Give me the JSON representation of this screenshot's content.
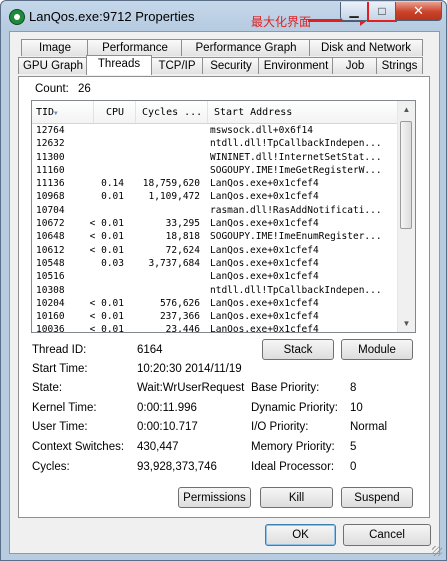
{
  "window": {
    "title": "LanQos.exe:9712 Properties",
    "annotation": "最大化界面",
    "controls": {
      "minimize": "▁",
      "maximize": "□",
      "close": "✕"
    }
  },
  "tabs_row1": [
    "Image",
    "Performance",
    "Performance Graph",
    "Disk and Network"
  ],
  "tabs_row2": [
    "GPU Graph",
    "Threads",
    "TCP/IP",
    "Security",
    "Environment",
    "Job",
    "Strings"
  ],
  "active_tab": "Threads",
  "count": {
    "label": "Count:",
    "value": "26"
  },
  "thread_list": {
    "columns": [
      "TID",
      "CPU",
      "Cycles ...",
      "Start Address"
    ],
    "rows": [
      [
        "12764",
        "",
        "",
        "mswsock.dll+0x6f14"
      ],
      [
        "12632",
        "",
        "",
        "ntdll.dll!TpCallbackIndepen..."
      ],
      [
        "11300",
        "",
        "",
        "WININET.dll!InternetSetStat..."
      ],
      [
        "11160",
        "",
        "",
        "SOGOUPY.IME!ImeGetRegisterW..."
      ],
      [
        "11136",
        "0.14",
        "18,759,620",
        "LanQos.exe+0x1cfef4"
      ],
      [
        "10968",
        "0.01",
        "1,109,472",
        "LanQos.exe+0x1cfef4"
      ],
      [
        "10704",
        "",
        "",
        "rasman.dll!RasAddNotificati..."
      ],
      [
        "10672",
        "< 0.01",
        "33,295",
        "LanQos.exe+0x1cfef4"
      ],
      [
        "10648",
        "< 0.01",
        "18,818",
        "SOGOUPY.IME!ImeEnumRegister..."
      ],
      [
        "10612",
        "< 0.01",
        "72,624",
        "LanQos.exe+0x1cfef4"
      ],
      [
        "10548",
        "0.03",
        "3,737,684",
        "LanQos.exe+0x1cfef4"
      ],
      [
        "10516",
        "",
        "",
        "LanQos.exe+0x1cfef4"
      ],
      [
        "10308",
        "",
        "",
        "ntdll.dll!TpCallbackIndepen..."
      ],
      [
        "10204",
        "< 0.01",
        "576,626",
        "LanQos.exe+0x1cfef4"
      ],
      [
        "10160",
        "< 0.01",
        "237,366",
        "LanQos.exe+0x1cfef4"
      ],
      [
        "10036",
        "< 0.01",
        "23,446",
        "LanQos.exe+0x1cfef4"
      ]
    ]
  },
  "details": {
    "thread_id": {
      "label": "Thread ID:",
      "value": "6164"
    },
    "start_time": {
      "label": "Start Time:",
      "value": "10:20:30   2014/11/19"
    },
    "state": {
      "label": "State:",
      "value": "Wait:WrUserRequest"
    },
    "base_priority": {
      "label": "Base Priority:",
      "value": "8"
    },
    "kernel_time": {
      "label": "Kernel Time:",
      "value": "0:00:11.996"
    },
    "dynamic_priority": {
      "label": "Dynamic Priority:",
      "value": "10"
    },
    "user_time": {
      "label": "User Time:",
      "value": "0:00:10.717"
    },
    "io_priority": {
      "label": "I/O Priority:",
      "value": "Normal"
    },
    "context_switches": {
      "label": "Context Switches:",
      "value": "430,447"
    },
    "memory_priority": {
      "label": "Memory Priority:",
      "value": "5"
    },
    "cycles": {
      "label": "Cycles:",
      "value": "93,928,373,746"
    },
    "ideal_processor": {
      "label": "Ideal Processor:",
      "value": "0"
    }
  },
  "buttons": {
    "stack": "Stack",
    "module": "Module",
    "permissions": "Permissions",
    "kill": "Kill",
    "suspend": "Suspend",
    "ok": "OK",
    "cancel": "Cancel"
  },
  "colors": {
    "accent_red": "#e02020",
    "title_bar": "#b7cbe1",
    "close_button": "#c9422a"
  }
}
